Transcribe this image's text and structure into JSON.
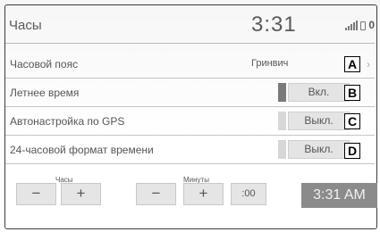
{
  "header": {
    "title": "Часы",
    "clock": "3:31",
    "status_icons": [
      "signal-bars-icon",
      "phone-icon",
      "notification-icon"
    ],
    "status_glyph": "0"
  },
  "rows": [
    {
      "label": "Часовой пояс",
      "value": "Гринвич",
      "callout": "A"
    },
    {
      "label": "Летнее время",
      "state": "Вкл.",
      "on": true,
      "callout": "B"
    },
    {
      "label": "Автонастройка по GPS",
      "state": "Выкл.",
      "on": false,
      "callout": "C"
    },
    {
      "label": "24-часовой формат времени",
      "state": "Выкл.",
      "on": false,
      "callout": "D"
    }
  ],
  "chevron": "›",
  "hours": {
    "caption": "Часы",
    "minus": "−",
    "plus": "+"
  },
  "minutes": {
    "caption": "Минуты",
    "minus": "−",
    "plus": "+",
    "reset": ":00"
  },
  "current_time": "3:31 AM"
}
